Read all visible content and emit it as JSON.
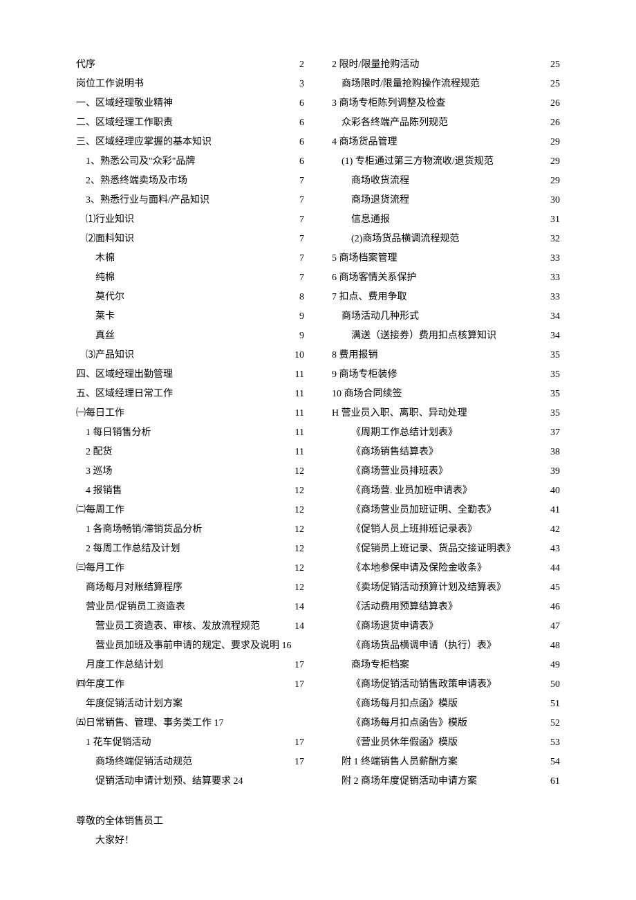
{
  "left": [
    {
      "label": "代序",
      "page": "2",
      "indent": 0
    },
    {
      "label": "岗位工作说明书",
      "page": "3",
      "indent": 0
    },
    {
      "label": "一、区域经理敬业精神",
      "page": "6",
      "indent": 0
    },
    {
      "label": "二、区域经理工作职责",
      "page": "6",
      "indent": 0
    },
    {
      "label": "三、区域经理应掌握的基本知识",
      "page": "6",
      "indent": 0
    },
    {
      "label": "1、熟悉公司及\"众彩\"品牌",
      "page": "6",
      "indent": 1
    },
    {
      "label": "2、熟悉终端卖场及市场",
      "page": "7",
      "indent": 1
    },
    {
      "label": "3、熟悉行业与面料/产品知识",
      "page": "7",
      "indent": 1
    },
    {
      "label": "⑴行业知识",
      "page": "7",
      "indent": 1
    },
    {
      "label": "⑵面料知识",
      "page": "7",
      "indent": 1
    },
    {
      "label": "木棉",
      "page": "7",
      "indent": 2
    },
    {
      "label": "纯棉",
      "page": "7",
      "indent": 2
    },
    {
      "label": "莫代尔",
      "page": "8",
      "indent": 2
    },
    {
      "label": "莱卡",
      "page": "9",
      "indent": 2
    },
    {
      "label": "真丝",
      "page": "9",
      "indent": 2
    },
    {
      "label": "⑶产品知识",
      "page": "10",
      "indent": 1
    },
    {
      "label": "四、区域经理出勤管理",
      "page": "11",
      "indent": 0
    },
    {
      "label": "五、区域经理日常工作",
      "page": "11",
      "indent": 0
    },
    {
      "label": "㈠每日工作",
      "page": "11",
      "indent": 0
    },
    {
      "label": "1 每日销售分析",
      "page": "11",
      "indent": 1
    },
    {
      "label": "2 配货",
      "page": "11",
      "indent": 1
    },
    {
      "label": "3 巡场",
      "page": "12",
      "indent": 1
    },
    {
      "label": "4 报销售",
      "page": "12",
      "indent": 1
    },
    {
      "label": "㈡每周工作",
      "page": "12",
      "indent": 0
    },
    {
      "label": "1 各商场畅销/滞销货品分析",
      "page": "12",
      "indent": 1
    },
    {
      "label": "2 每周工作总结及计划",
      "page": "12",
      "indent": 1
    },
    {
      "label": "㈢每月工作",
      "page": "12",
      "indent": 0
    },
    {
      "label": "商场每月对账结算程序",
      "page": "12",
      "indent": 1
    },
    {
      "label": "营业员/促销员工资造表",
      "page": "14",
      "indent": 1
    },
    {
      "label": "营业员工资造表、审核、发放流程规范",
      "page": "14",
      "indent": 2
    },
    {
      "label": "营业员加班及事前申请的规定、要求及说明 16",
      "page": "",
      "indent": 2
    },
    {
      "label": "月度工作总结计划",
      "page": "17",
      "indent": 1
    },
    {
      "label": "㈣年度工作",
      "page": "17",
      "indent": 0
    },
    {
      "label": "年度促销活动计划方案",
      "page": "",
      "indent": 1
    },
    {
      "label": "㈤日常销售、管理、事务类工作 17",
      "page": "",
      "indent": 0
    },
    {
      "label": "1 花车促销活动",
      "page": "17",
      "indent": 1
    },
    {
      "label": "商场终端促销活动规范",
      "page": "17",
      "indent": 2
    },
    {
      "label": "促销活动申请计划预、结算要求 24",
      "page": "",
      "indent": 2
    }
  ],
  "right": [
    {
      "label": "2 限时/限量抢购活动",
      "page": "25",
      "indent": 0
    },
    {
      "label": "商场限时/限量抢购操作流程规范",
      "page": "25",
      "indent": 1
    },
    {
      "label": "3 商场专柜陈列调整及检查",
      "page": "26",
      "indent": 0
    },
    {
      "label": "众彩各终端产品陈列规范",
      "page": "26",
      "indent": 1
    },
    {
      "label": "4 商场货品管理",
      "page": "29",
      "indent": 0
    },
    {
      "label": "(1) 专柜通过第三方物流收/退货规范",
      "page": "29",
      "indent": 1
    },
    {
      "label": "商场收货流程",
      "page": "29",
      "indent": 2
    },
    {
      "label": "商场退货流程",
      "page": "30",
      "indent": 2
    },
    {
      "label": "信息通报",
      "page": "31",
      "indent": 2
    },
    {
      "label": "(2)商场货品横调流程规范",
      "page": "32",
      "indent": 2
    },
    {
      "label": "5 商场档案管理",
      "page": "33",
      "indent": 0
    },
    {
      "label": "6 商场客情关系保护",
      "page": "33",
      "indent": 0
    },
    {
      "label": "7 扣点、费用争取",
      "page": "33",
      "indent": 0
    },
    {
      "label": "商场活动几种形式",
      "page": "34",
      "indent": 1
    },
    {
      "label": "满送（送接券）费用扣点核算知识",
      "page": "34",
      "indent": 2
    },
    {
      "label": "8 费用报销",
      "page": "35",
      "indent": 0
    },
    {
      "label": "9 商场专柜装修",
      "page": "35",
      "indent": 0
    },
    {
      "label": "10 商场合同续签",
      "page": "35",
      "indent": 0
    },
    {
      "label": "H 营业员入职、离职、异动处理",
      "page": "35",
      "indent": 0
    },
    {
      "label": "《周期工作总结计划表》",
      "page": "37",
      "indent": 2
    },
    {
      "label": "《商场销售结算表》",
      "page": "38",
      "indent": 2
    },
    {
      "label": "《商场营业员排班表》",
      "page": "39",
      "indent": 2
    },
    {
      "label": "《商场营. 业员加班申请表》",
      "page": "40",
      "indent": 2
    },
    {
      "label": "《商场营业员加班证明、全勤表》",
      "page": "41",
      "indent": 2
    },
    {
      "label": "《促销人员上班排班记录表》",
      "page": "42",
      "indent": 2
    },
    {
      "label": "《促销员上班记录、货品交接证明表》",
      "page": "43",
      "indent": 2
    },
    {
      "label": "《本地参保申请及保险金收条》",
      "page": "44",
      "indent": 2
    },
    {
      "label": "《卖场促销活动预算计划及结算表》",
      "page": "45",
      "indent": 2
    },
    {
      "label": "《活动费用预算结算表》",
      "page": "46",
      "indent": 2
    },
    {
      "label": "《商场退货申请表》",
      "page": "47",
      "indent": 2
    },
    {
      "label": "《商场货品横调申请（执行）表》",
      "page": "48",
      "indent": 2
    },
    {
      "label": "商场专柜档案",
      "page": "49",
      "indent": 2
    },
    {
      "label": "《商场促销活动销售政策申请表》",
      "page": "50",
      "indent": 2
    },
    {
      "label": "《商场每月扣点函》模版",
      "page": "51",
      "indent": 2
    },
    {
      "label": "《商场每月扣点函告》模版",
      "page": "52",
      "indent": 2
    },
    {
      "label": "《营业员休年假函》模版",
      "page": "53",
      "indent": 2
    },
    {
      "label": "附 1 终端销售人员薪酬方案",
      "page": "54",
      "indent": 1
    },
    {
      "label": "附 2 商场年度促销活动申请方案",
      "page": "61",
      "indent": 1
    }
  ],
  "footer": {
    "line1": "尊敬的全体销售员工",
    "line2": "大家好！"
  }
}
